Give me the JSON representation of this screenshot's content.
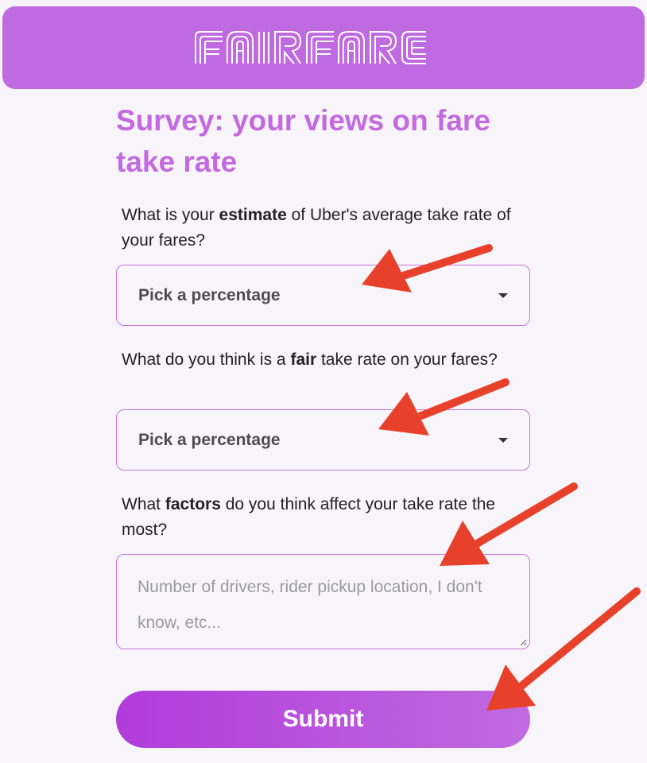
{
  "header": {
    "logo_text": "FAIRFARE",
    "background": "#c06ae2"
  },
  "survey": {
    "title": "Survey: your views on fare take rate",
    "q1": {
      "pre": "What is your ",
      "bold": "estimate",
      "post": " of Uber's average take rate of your fares?"
    },
    "q2": {
      "pre": "What do you think is a ",
      "bold": "fair",
      "post": " take rate on your fares?"
    },
    "q3": {
      "pre": "What ",
      "bold": "factors",
      "post": " do you think affect your take rate the most?"
    },
    "select1": {
      "value": "Pick a percentage"
    },
    "select2": {
      "value": "Pick a percentage"
    },
    "textarea": {
      "placeholder": "Number of drivers, rider pickup location, I don't know, etc..."
    },
    "submit_label": "Submit"
  },
  "colors": {
    "accent": "#c36ae0",
    "annotation_arrow": "#e8412b"
  }
}
